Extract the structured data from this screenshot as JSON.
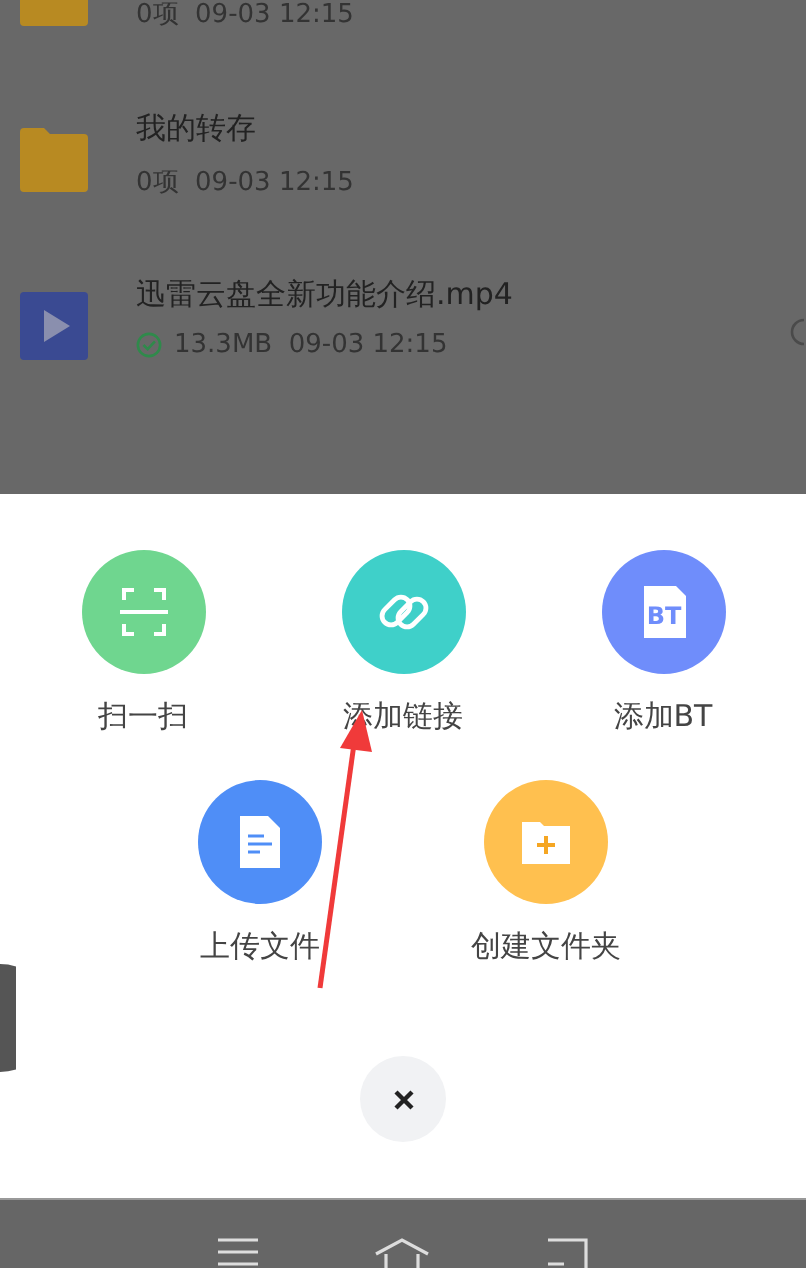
{
  "files": [
    {
      "kind": "folder",
      "meta": "0项  09-03 12:15"
    },
    {
      "kind": "folder",
      "title": "我的转存",
      "meta": "0项  09-03 12:15"
    },
    {
      "kind": "video",
      "title": "迅雷云盘全新功能介绍.mp4",
      "meta": "13.3MB  09-03 12:15",
      "synced": true
    }
  ],
  "actions": [
    [
      {
        "kind": "scan",
        "label": "扫一扫",
        "color": "#6fd68f"
      },
      {
        "kind": "link",
        "label": "添加链接",
        "color": "#3fd0c9"
      },
      {
        "kind": "bt",
        "label": "添加BT",
        "badge": "BT",
        "color": "#6f8dfb"
      }
    ],
    [
      {
        "kind": "upload",
        "label": "上传文件",
        "color": "#4f8ef7"
      },
      {
        "kind": "newfolder",
        "label": "创建文件夹",
        "color": "#ffc04f"
      }
    ]
  ]
}
